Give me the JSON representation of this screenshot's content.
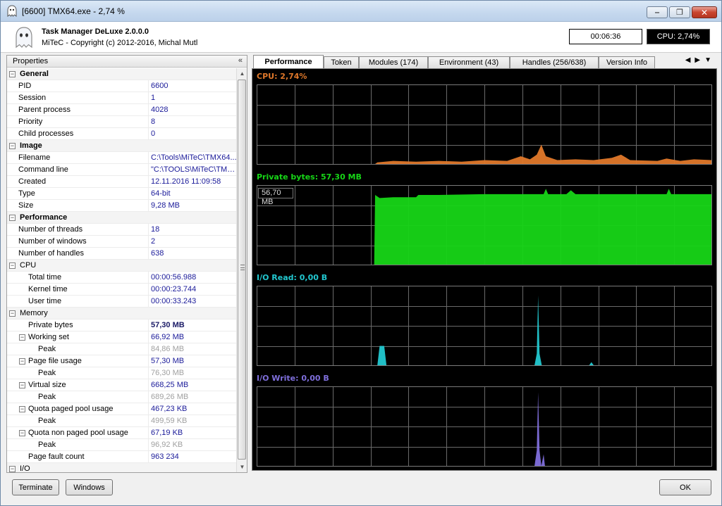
{
  "window": {
    "title": "[6600] TMX64.exe - 2,74 %",
    "minimize_glyph": "‒",
    "maximize_glyph": "❐",
    "close_glyph": "✕"
  },
  "header": {
    "app_name": "Task Manager DeLuxe 2.0.0.0",
    "copyright": "MiTeC - Copyright (c) 2012-2016, Michal Mutl",
    "elapsed_time": "00:06:36",
    "cpu_status": "CPU: 2,74%"
  },
  "properties": {
    "title": "Properties",
    "collapse_glyph": "«",
    "rows": [
      {
        "kind": "category",
        "label": "General",
        "bold": true
      },
      {
        "kind": "item",
        "label": "PID",
        "value": "6600"
      },
      {
        "kind": "item",
        "label": "Session",
        "value": "1"
      },
      {
        "kind": "item",
        "label": "Parent process",
        "value": "4028"
      },
      {
        "kind": "item",
        "label": "Priority",
        "value": "8"
      },
      {
        "kind": "item",
        "label": "Child processes",
        "value": "0"
      },
      {
        "kind": "category",
        "label": "Image",
        "bold": true
      },
      {
        "kind": "item",
        "label": "Filename",
        "value": "C:\\Tools\\MiTeC\\TMX64..."
      },
      {
        "kind": "item",
        "label": "Command line",
        "value": "\"C:\\TOOLS\\MiTeC\\TMX..."
      },
      {
        "kind": "item",
        "label": "Created",
        "value": "12.11.2016 11:09:58"
      },
      {
        "kind": "item",
        "label": "Type",
        "value": "64-bit"
      },
      {
        "kind": "item",
        "label": "Size",
        "value": "9,28 MB"
      },
      {
        "kind": "category",
        "label": "Performance",
        "bold": true
      },
      {
        "kind": "item",
        "label": "Number of threads",
        "value": "18"
      },
      {
        "kind": "item",
        "label": "Number of windows",
        "value": "2"
      },
      {
        "kind": "item",
        "label": "Number of handles",
        "value": "638"
      },
      {
        "kind": "category",
        "label": "CPU",
        "bold": false
      },
      {
        "kind": "sub",
        "label": "Total time",
        "value": "00:00:56.988"
      },
      {
        "kind": "sub",
        "label": "Kernel time",
        "value": "00:00:23.744"
      },
      {
        "kind": "sub",
        "label": "User time",
        "value": "00:00:33.243"
      },
      {
        "kind": "category",
        "label": "Memory",
        "bold": false
      },
      {
        "kind": "sub",
        "label": "Private bytes",
        "value": "57,30 MB",
        "bold": true
      },
      {
        "kind": "subcat",
        "label": "Working set",
        "value": "66,92 MB"
      },
      {
        "kind": "peak",
        "label": "Peak",
        "value": "84,86 MB"
      },
      {
        "kind": "subcat",
        "label": "Page file usage",
        "value": "57,30 MB"
      },
      {
        "kind": "peak",
        "label": "Peak",
        "value": "76,30 MB"
      },
      {
        "kind": "subcat",
        "label": "Virtual size",
        "value": "668,25 MB"
      },
      {
        "kind": "peak",
        "label": "Peak",
        "value": "689,26 MB"
      },
      {
        "kind": "subcat",
        "label": "Quota paged pool usage",
        "value": "467,23 KB"
      },
      {
        "kind": "peak",
        "label": "Peak",
        "value": "499,59 KB"
      },
      {
        "kind": "subcat",
        "label": "Quota non paged pool usage",
        "value": "67,19 KB"
      },
      {
        "kind": "peak",
        "label": "Peak",
        "value": "96,92 KB"
      },
      {
        "kind": "sub",
        "label": "Page fault count",
        "value": "963 234"
      },
      {
        "kind": "category",
        "label": "I/O",
        "bold": false
      }
    ]
  },
  "tabs": [
    {
      "label": "Performance",
      "active": true
    },
    {
      "label": "Token",
      "active": false
    },
    {
      "label": "Modules (174)",
      "active": false
    },
    {
      "label": "Environment (43)",
      "active": false
    },
    {
      "label": "Handles (256/638)",
      "active": false
    },
    {
      "label": "Version Info",
      "active": false
    }
  ],
  "tab_nav": {
    "prev": "◀",
    "next": "▶",
    "menu": "▼"
  },
  "graphs": [
    {
      "title": "CPU: 2,74%",
      "color": "#e0782a",
      "fill": true
    },
    {
      "title": "Private bytes: 57,30 MB",
      "color": "#17d617",
      "fill": true,
      "scale_label": "56,70 MB"
    },
    {
      "title": "I/O Read: 0,00 B",
      "color": "#22c8d0",
      "fill": true
    },
    {
      "title": "I/O Write: 0,00 B",
      "color": "#7f6fdc",
      "fill": true
    }
  ],
  "buttons": {
    "terminate": "Terminate",
    "windows": "Windows",
    "ok": "OK"
  }
}
